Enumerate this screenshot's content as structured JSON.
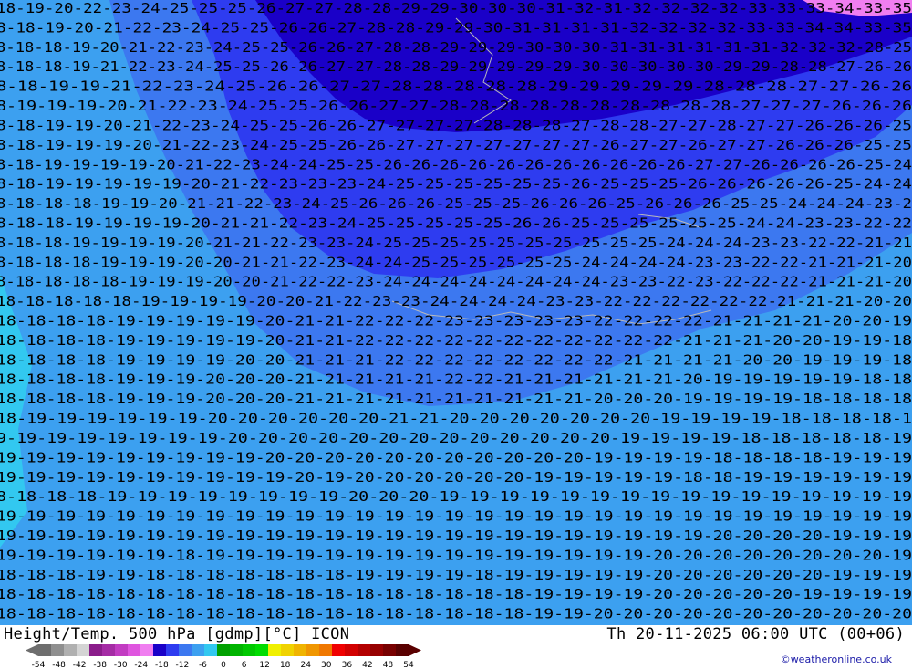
{
  "footer": {
    "left_title": "Height/Temp. 500 hPa [gdmp][°C] ICON",
    "right_title": "Th 20-11-2025 06:00 UTC (00+06)",
    "credit": "©weatheronline.co.uk"
  },
  "legend": {
    "ticks": [
      "-54",
      "-48",
      "-42",
      "-38",
      "-30",
      "-24",
      "-18",
      "-12",
      "-6",
      "0",
      "6",
      "12",
      "18",
      "24",
      "30",
      "36",
      "42",
      "48",
      "54"
    ],
    "colors": [
      "#6e6e6e",
      "#8f8f8f",
      "#b0b0b0",
      "#d4d4d4",
      "#8a1d8a",
      "#a52ca5",
      "#c23cc2",
      "#df55df",
      "#f07ef0",
      "#1a00c8",
      "#2e3cf0",
      "#3c78f0",
      "#3ca0f0",
      "#32c8f0",
      "#00a000",
      "#00b400",
      "#00c800",
      "#00dc00",
      "#f0f000",
      "#f0d200",
      "#f0b400",
      "#f09600",
      "#f07800",
      "#f00000",
      "#d20000",
      "#b40000",
      "#960000",
      "#780000",
      "#5a0000"
    ]
  },
  "map": {
    "fill_colors": {
      "band_28_34": "#1a00c8",
      "band_24_28": "#2e3cf0",
      "band_21_24": "#3c78f0",
      "band_19_21": "#3ca0f0",
      "band_16_19": "#32c8f0",
      "band_top": "#f07ef0"
    },
    "contour_rows": [
      "18-19-20-22-23-24-25-25-25-26-27-27-28-28-29-29-30-30-30-31-32-31-32-32-32-32-33-33-33-34-33-35",
      "8-18-19-20-21-22-23-24-25-25-26-26-27-28-28-29-29-30-31-31-31-31-32-32-32-32-33-33-34-34-33-35",
      "8-18-18-19-20-21-22-23-24-25-25-26-26-27-28-28-29-29-29-30-30-30-31-31-31-31-31-31-32-32-32-28-25",
      "8-18-18-19-21-22-23-24-25-25-26-26-27-27-28-28-29-29-29-29-29-30-30-30-30-30-29-29-28-28-27-26-26",
      "8-18-19-19-21-22-23-24-25-26-26-27-27-28-28-28-28-28-29-29-29-29-29-28-28-28-27-27-26-26",
      "8-19-19-19-20-21-22-23-24-25-25-26-26-27-27-28-28-28-28-28-28-28-28-28-28-27-27-27-26-26-26",
      "8-18-19-19-20-21-22-23-24-25-25-26-26-27-27-27-27-28-28-28-27-28-28-27-27-28-27-27-26-26-26-25",
      "8-18-19-19-19-20-21-22-23-24-25-25-26-26-27-27-27-27-27-27-27-26-27-27-26-27-27-26-26-26-25-25",
      "8-18-19-19-19-19-20-21-22-23-24-24-25-25-26-26-26-26-26-26-26-26-26-26-26-27-27-26-26-26-26-25-24",
      "8-18-19-19-19-19-19-20-21-22-23-23-23-24-25-25-25-25-25-25-26-25-25-25-26-26-26-26-26-25-24-24",
      "8-18-18-18-19-19-20-21-21-22-23-24-25-26-26-26-25-25-25-26-26-26-25-26-26-26-25-25-24-24-24-23-2",
      "8-18-18-19-19-19-19-20-21-21-22-23-24-25-25-25-25-25-26-26-25-25-25-25-25-25-24-24-23-23-22-22",
      "8-18-18-19-19-19-19-20-21-21-22-23-23-24-25-25-25-25-25-25-25-25-25-25-24-24-24-23-23-22-22-21-21",
      "8-18-18-18-19-19-19-20-20-21-21-22-23-24-24-25-25-25-25-25-25-24-24-24-24-23-23-22-22-21-21-21-20",
      "8-18-18-18-18-19-19-19-20-20-21-22-22-23-24-24-24-24-24-24-24-24-23-23-22-23-22-22-22-21-21-21-20",
      "18-18-18-18-18-19-19-19-19-20-20-21-22-23-23-24-24-24-24-23-23-22-22-22-22-22-22-21-21-21-20-20",
      "18-18-18-18-19-19-19-19-19-20-21-21-22-22-22-23-23-23-23-23-22-22-22-22-21-21-21-21-20-20-19",
      "18-18-18-18-19-19-19-19-19-20-21-21-22-22-22-22-22-22-22-22-22-22-22-21-21-21-20-20-19-19-18",
      "18-18-18-18-19-19-19-19-20-20-21-21-21-22-22-22-22-22-22-22-22-21-21-21-21-20-20-19-19-19-18",
      "18-18-18-18-19-19-19-20-20-20-21-21-21-21-21-22-22-21-21-21-21-21-21-20-19-19-19-19-19-18-18",
      "18-18-18-18-19-19-19-20-20-20-21-21-21-21-21-21-21-21-21-21-20-20-20-19-19-19-19-18-18-18-18",
      "18-19-19-19-19-19-19-20-20-20-20-20-20-21-21-20-20-20-20-20-20-20-19-19-19-19-18-18-18-18-1",
      "9-19-19-19-19-19-19-19-20-20-20-20-20-20-20-20-20-20-20-20-20-19-19-19-19-18-18-18-18-18-19",
      "19-19-19-19-19-19-19-19-19-20-20-20-20-20-20-20-20-20-20-20-19-19-19-19-18-18-18-18-19-19-19",
      "19-19-19-19-19-19-19-19-19-19-20-19-20-20-20-20-20-20-19-19-19-19-19-18-18-19-19-19-19-19-19",
      "8-18-18-18-19-19-19-19-19-19-19-19-20-20-20-19-19-19-19-19-19-19-19-19-19-19-19-19-19-19-19",
      "19-19-19-19-19-19-19-19-19-19-19-19-19-19-19-19-19-19-19-19-19-19-19-19-19-19-19-19-19-19-19",
      "19-19-19-19-19-19-19-19-19-19-19-19-19-19-19-19-19-19-19-19-19-19-19-19-20-20-20-20-19-19-19",
      "19-19-19-19-19-19-18-19-19-19-19-19-19-19-19-19-19-19-19-19-19-19-20-20-20-20-20-20-20-20-19",
      "18-18-18-19-19-18-18-18-18-18-18-18-19-19-19-19-18-19-19-19-19-19-20-20-20-20-20-20-19-19-19",
      "18-18-18-18-18-18-18-18-18-18-18-18-18-18-18-18-18-18-19-19-19-19-20-20-20-20-20-19-19-19-19",
      "18-18-18-18-18-18-18-18-18-18-18-18-18-18-18-18-18-18-19-19-20-20-20-20-20-20-20-20-20-20-20"
    ]
  }
}
